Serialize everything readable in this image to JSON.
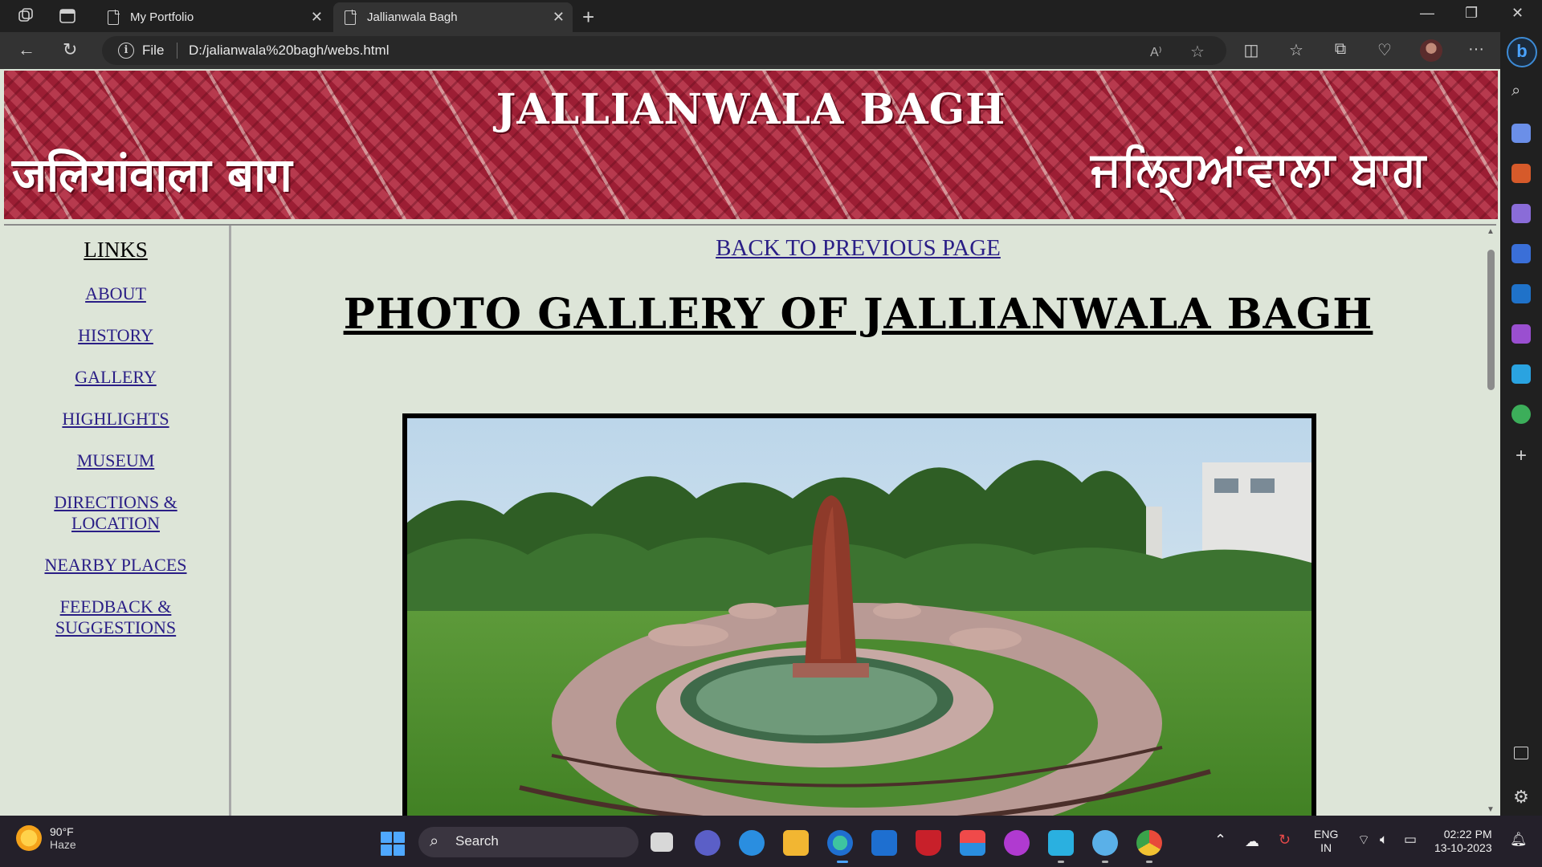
{
  "browser": {
    "tabs": [
      {
        "title": "My Portfolio",
        "active": false
      },
      {
        "title": "Jallianwala Bagh",
        "active": true
      }
    ],
    "address": {
      "scheme_label": "File",
      "url": "D:/jalianwala%20bagh/webs.html"
    }
  },
  "page": {
    "banner": {
      "title": "JALLIANWALA BAGH",
      "hindi": "जलियांवाला बाग",
      "punjabi": "ਜਲ੍ਹਿਆਂਵਾਲਾ ਬਾਗ"
    },
    "sidebar": {
      "heading": "LINKS",
      "links": [
        {
          "label": "ABOUT"
        },
        {
          "label": "HISTORY"
        },
        {
          "label": "GALLERY"
        },
        {
          "label": "HIGHLIGHTS"
        },
        {
          "label": "MUSEUM"
        },
        {
          "label": "DIRECTIONS & LOCATION"
        },
        {
          "label": "NEARBY PLACES"
        },
        {
          "label": "FEEDBACK & SUGGESTIONS"
        }
      ]
    },
    "main": {
      "back_link": "BACK TO PREVIOUS PAGE",
      "title": "PHOTO GALLERY OF JALLIANWALA BAGH"
    }
  },
  "taskbar": {
    "weather": {
      "temp": "90°F",
      "condition": "Haze"
    },
    "search_label": "Search",
    "language": {
      "line1": "ENG",
      "line2": "IN"
    },
    "clock": {
      "time": "02:22 PM",
      "date": "13-10-2023"
    }
  },
  "colors": {
    "link": "#2a1e86",
    "page_bg": "#dde5d8",
    "banner": "#a52a3e"
  }
}
